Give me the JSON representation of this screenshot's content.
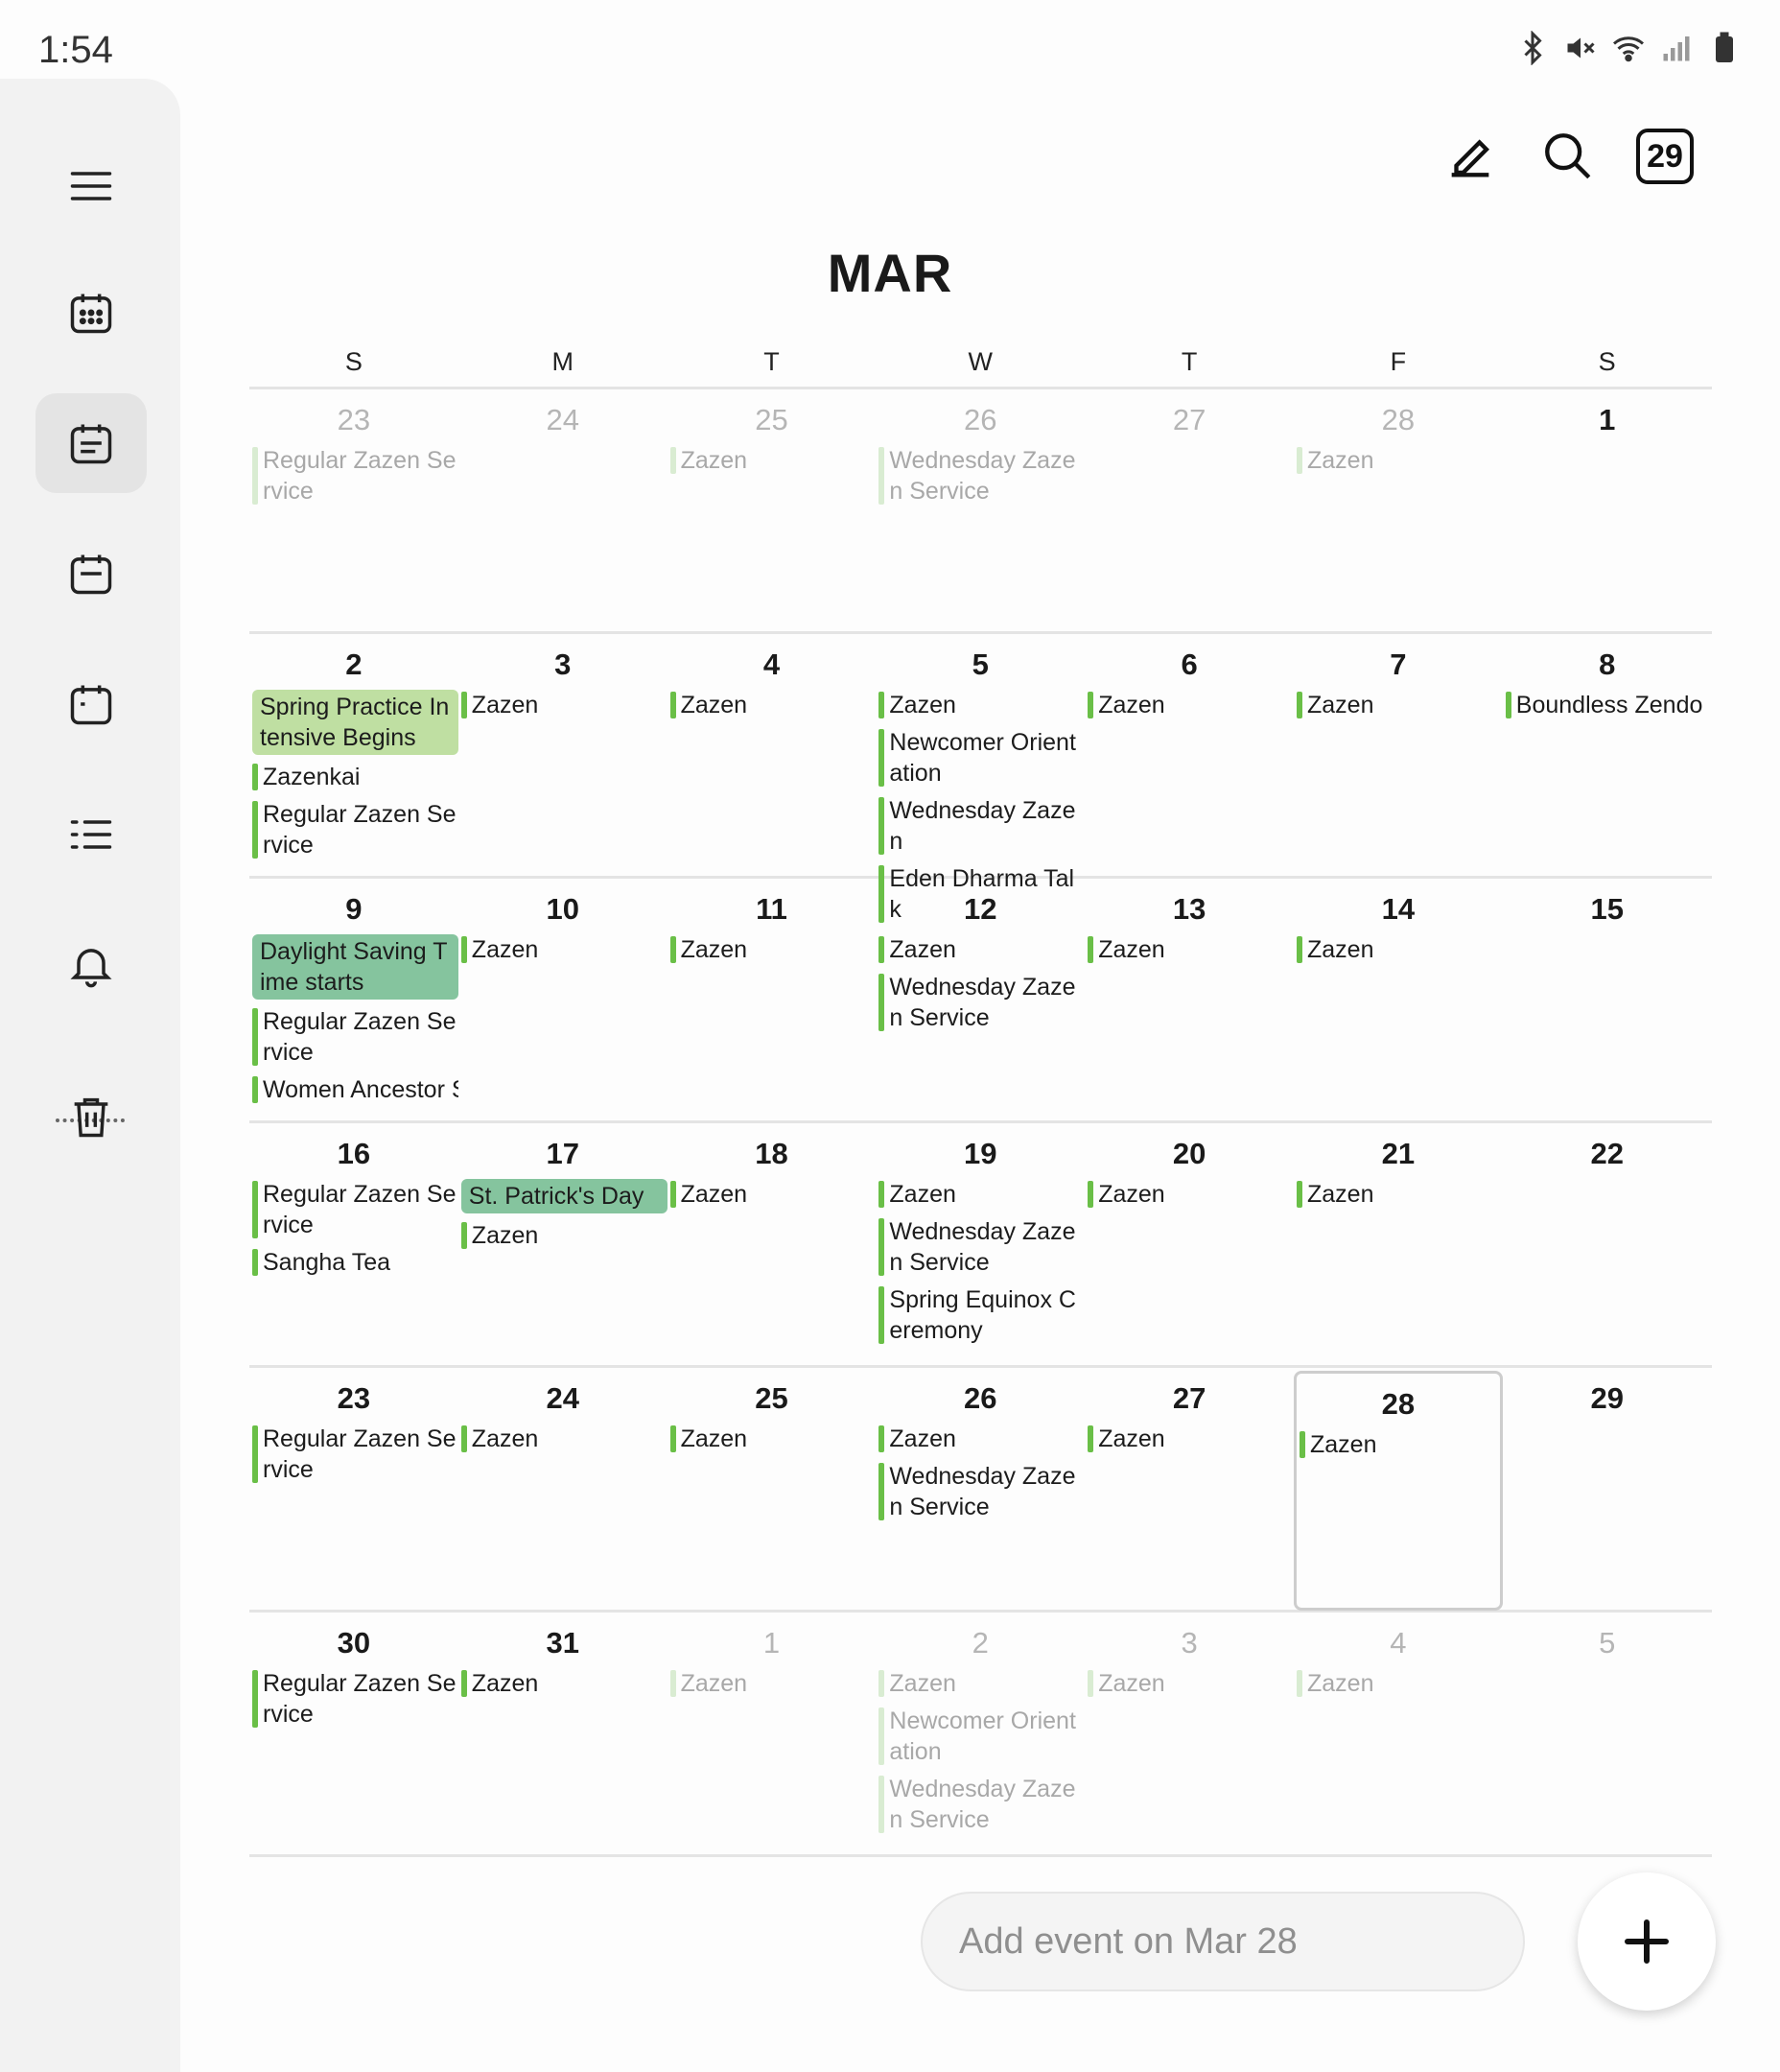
{
  "status": {
    "time": "1:54",
    "icons": [
      "bluetooth-icon",
      "mute-icon",
      "wifi-icon",
      "signal-icon",
      "battery-icon"
    ]
  },
  "sidebar": {
    "items": [
      {
        "name": "menu",
        "icon": "menu-icon"
      },
      {
        "name": "month-view",
        "icon": "calendar-grid-icon"
      },
      {
        "name": "week-view",
        "icon": "calendar-list-icon",
        "active": true
      },
      {
        "name": "day-view",
        "icon": "calendar-day-icon"
      },
      {
        "name": "3day-view",
        "icon": "calendar-blank-icon"
      },
      {
        "name": "agenda",
        "icon": "list-icon"
      },
      {
        "name": "reminders",
        "icon": "bell-icon"
      },
      {
        "name": "trash",
        "icon": "trash-icon"
      }
    ]
  },
  "toolbar": {
    "today_label": "29"
  },
  "month": "MAR",
  "weekdays": [
    "S",
    "M",
    "T",
    "W",
    "T",
    "F",
    "S"
  ],
  "weeks": [
    [
      {
        "day": "23",
        "faded": true,
        "events": [
          {
            "title": "Regular Zazen Service"
          }
        ]
      },
      {
        "day": "24",
        "faded": true,
        "events": []
      },
      {
        "day": "25",
        "faded": true,
        "events": [
          {
            "title": "Zazen"
          }
        ]
      },
      {
        "day": "26",
        "faded": true,
        "events": [
          {
            "title": "Wednesday Zazen Service"
          }
        ]
      },
      {
        "day": "27",
        "faded": true,
        "events": []
      },
      {
        "day": "28",
        "faded": true,
        "events": [
          {
            "title": "Zazen"
          }
        ]
      },
      {
        "day": "1",
        "events": []
      }
    ],
    [
      {
        "day": "2",
        "events": [
          {
            "title": "Spring Practice Intensive Begins",
            "style": "light"
          },
          {
            "title": "Zazenkai"
          },
          {
            "title": "Regular Zazen Service"
          }
        ]
      },
      {
        "day": "3",
        "events": [
          {
            "title": "Zazen"
          }
        ]
      },
      {
        "day": "4",
        "events": [
          {
            "title": "Zazen"
          }
        ]
      },
      {
        "day": "5",
        "events": [
          {
            "title": "Zazen"
          },
          {
            "title": "Newcomer Orientation"
          },
          {
            "title": "Wednesday Zazen"
          },
          {
            "title": "Eden Dharma Talk"
          }
        ]
      },
      {
        "day": "6",
        "events": [
          {
            "title": "Zazen"
          }
        ]
      },
      {
        "day": "7",
        "events": [
          {
            "title": "Zazen"
          }
        ]
      },
      {
        "day": "8",
        "events": [
          {
            "title": "Boundless Zendo"
          }
        ]
      }
    ],
    [
      {
        "day": "9",
        "events": [
          {
            "title": "Daylight Saving Time starts",
            "style": "mid"
          },
          {
            "title": "Regular Zazen Service"
          },
          {
            "title": "Women Ancestor Service",
            "single": true
          }
        ]
      },
      {
        "day": "10",
        "events": [
          {
            "title": "Zazen"
          }
        ]
      },
      {
        "day": "11",
        "events": [
          {
            "title": "Zazen"
          }
        ]
      },
      {
        "day": "12",
        "events": [
          {
            "title": "Zazen"
          },
          {
            "title": "Wednesday Zazen Service"
          }
        ]
      },
      {
        "day": "13",
        "events": [
          {
            "title": "Zazen"
          }
        ]
      },
      {
        "day": "14",
        "events": [
          {
            "title": "Zazen"
          }
        ]
      },
      {
        "day": "15",
        "events": []
      }
    ],
    [
      {
        "day": "16",
        "events": [
          {
            "title": "Regular Zazen Service"
          },
          {
            "title": "Sangha Tea"
          }
        ]
      },
      {
        "day": "17",
        "events": [
          {
            "title": "St. Patrick's Day",
            "style": "mid",
            "single": true
          },
          {
            "title": "Zazen"
          }
        ]
      },
      {
        "day": "18",
        "events": [
          {
            "title": "Zazen"
          }
        ]
      },
      {
        "day": "19",
        "events": [
          {
            "title": "Zazen"
          },
          {
            "title": "Wednesday Zazen Service"
          },
          {
            "title": "Spring Equinox Ceremony"
          }
        ]
      },
      {
        "day": "20",
        "events": [
          {
            "title": "Zazen"
          }
        ]
      },
      {
        "day": "21",
        "events": [
          {
            "title": "Zazen"
          }
        ]
      },
      {
        "day": "22",
        "events": []
      }
    ],
    [
      {
        "day": "23",
        "events": [
          {
            "title": "Regular Zazen Service"
          }
        ]
      },
      {
        "day": "24",
        "events": [
          {
            "title": "Zazen"
          }
        ]
      },
      {
        "day": "25",
        "events": [
          {
            "title": "Zazen"
          }
        ]
      },
      {
        "day": "26",
        "events": [
          {
            "title": "Zazen"
          },
          {
            "title": "Wednesday Zazen Service"
          }
        ]
      },
      {
        "day": "27",
        "events": [
          {
            "title": "Zazen"
          }
        ]
      },
      {
        "day": "28",
        "selected": true,
        "events": [
          {
            "title": "Zazen"
          }
        ]
      },
      {
        "day": "29",
        "events": []
      }
    ],
    [
      {
        "day": "30",
        "events": [
          {
            "title": "Regular Zazen Service"
          }
        ]
      },
      {
        "day": "31",
        "events": [
          {
            "title": "Zazen"
          }
        ]
      },
      {
        "day": "1",
        "faded": true,
        "events": [
          {
            "title": "Zazen"
          }
        ]
      },
      {
        "day": "2",
        "faded": true,
        "events": [
          {
            "title": "Zazen"
          },
          {
            "title": "Newcomer Orientation"
          },
          {
            "title": "Wednesday Zazen Service"
          }
        ]
      },
      {
        "day": "3",
        "faded": true,
        "events": [
          {
            "title": "Zazen"
          }
        ]
      },
      {
        "day": "4",
        "faded": true,
        "events": [
          {
            "title": "Zazen"
          }
        ]
      },
      {
        "day": "5",
        "faded": true,
        "events": []
      }
    ]
  ],
  "add_event": {
    "placeholder": "Add event on Mar 28"
  },
  "colors": {
    "accent": "#6abf47",
    "event_light": "#bfdfa2",
    "event_mid": "#85c49e"
  }
}
